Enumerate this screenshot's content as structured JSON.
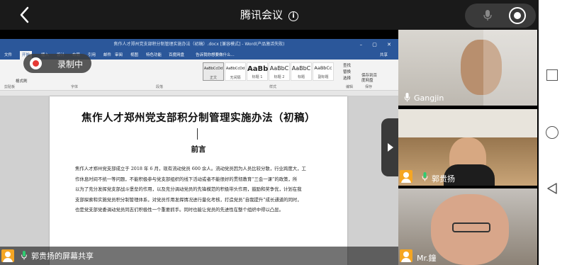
{
  "header": {
    "title": "腾讯会议",
    "info_icon": "info-icon"
  },
  "controls": {
    "mic_icon": "mic-icon",
    "stop_icon": "stop-record-icon"
  },
  "recording": {
    "label": "录制中"
  },
  "word": {
    "window_title": "焦作人才郑州党支部积分制管理实施办法（初稿）.docx [兼容模式] - Word(产品激活失败)",
    "tabs": [
      "文件",
      "开始",
      "插入",
      "设计",
      "布局",
      "引用",
      "邮件",
      "审阅",
      "视图",
      "特色功能",
      "百度网盘",
      "告诉我你想要做什么..."
    ],
    "share_button": "共享",
    "styles": [
      {
        "preview": "AaBbCcDd",
        "name": "正文"
      },
      {
        "preview": "AaBbCcDd",
        "name": "无间隔"
      },
      {
        "preview": "AaBb",
        "name": "标题 1"
      },
      {
        "preview": "AaBbC",
        "name": "标题 2"
      },
      {
        "preview": "AaBbC",
        "name": "标题"
      },
      {
        "preview": "AaBbCc",
        "name": "副标题"
      }
    ],
    "groups": [
      "剪贴板",
      "字体",
      "段落",
      "样式",
      "编辑",
      "保存"
    ],
    "edit_items": [
      "查找",
      "替换",
      "选择"
    ],
    "save_label": "保存到百度网盘",
    "paste_label": "格式刷"
  },
  "document": {
    "title": "焦作人才郑州党支部积分制管理实施办法（初稿）",
    "heading": "前言",
    "paragraph_lines": [
      "焦作人才郑州党支部成立于 2018 年 6 月，现有流动党员 600 余人。流动党员因为人员比较分散，行业跨度大，工",
      "作休息时间不统一等问题，不能积极参与党支部组织的线下活动或者不能很好的贯彻教育“三会一课”的政策，所",
      "以为了充分发挥党支部战斗堡垒的作用，以及充分调动党员的先锋模范的积极带头作用，鼓励和奖争优，计划在我",
      "支部探索和实施党员积分制管理体系，对党员作用发挥情况进行量化考核，打造党员“自我提升”成长通道的同时，",
      "也是党支部党委调动党员同志们积极性一个重要抓手。同时也能让党员的先进性在整个组织中得以凸显。"
    ]
  },
  "share_bar": {
    "label": "郭贵扬的屏幕共享"
  },
  "participants": [
    {
      "name": "Gangjin"
    },
    {
      "name": "郭贵扬"
    },
    {
      "name": "Mr.鐘"
    }
  ],
  "android_nav": [
    "recents-icon",
    "home-icon",
    "back-icon"
  ]
}
